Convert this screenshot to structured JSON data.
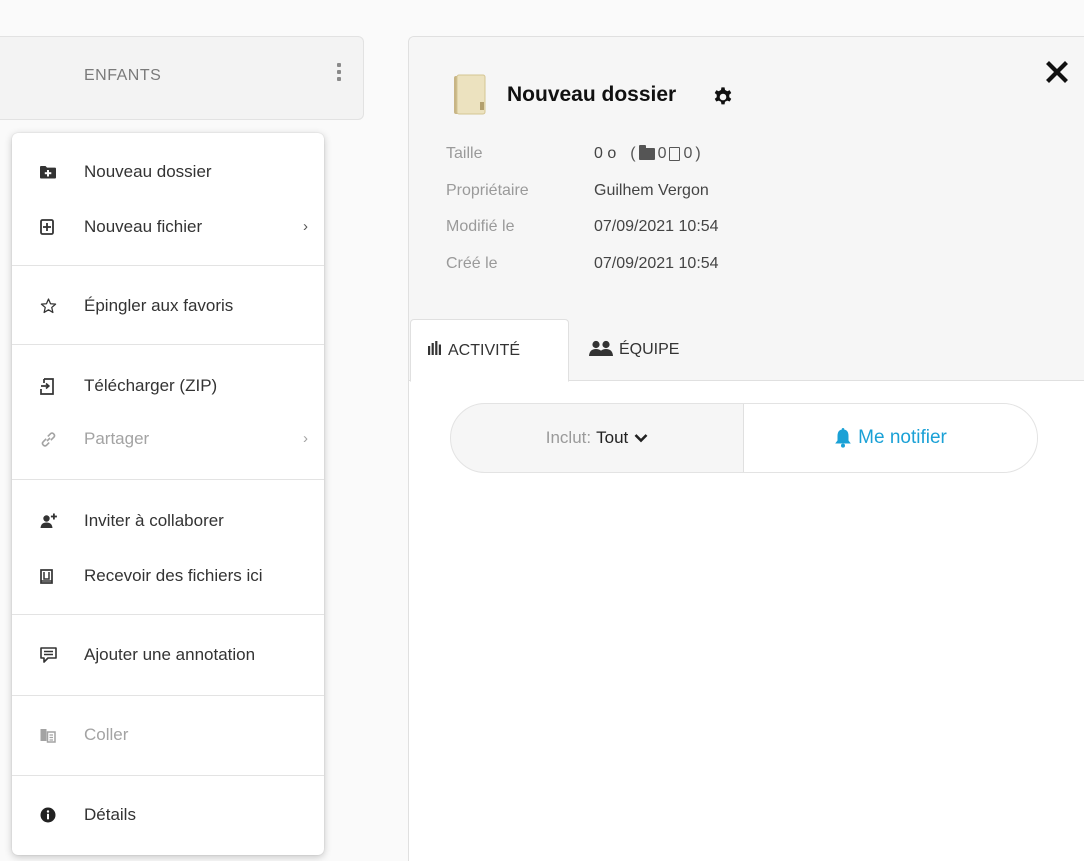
{
  "left_panel": {
    "title": "ENFANTS",
    "more_icon": "vertical-ellipsis-icon"
  },
  "context_menu": {
    "items": [
      {
        "label": "Nouveau dossier",
        "icon": "folder-plus-icon",
        "disabled": false,
        "submenu": false
      },
      {
        "label": "Nouveau fichier",
        "icon": "file-plus-icon",
        "disabled": false,
        "submenu": true
      },
      {
        "label": "Épingler aux favoris",
        "icon": "star-outline-icon",
        "disabled": false,
        "submenu": false
      },
      {
        "label": "Télécharger (ZIP)",
        "icon": "download-icon",
        "disabled": false,
        "submenu": false
      },
      {
        "label": "Partager",
        "icon": "share-link-icon",
        "disabled": true,
        "submenu": true
      },
      {
        "label": "Inviter à collaborer",
        "icon": "user-plus-icon",
        "disabled": false,
        "submenu": false
      },
      {
        "label": "Recevoir des fichiers ici",
        "icon": "inbox-upload-icon",
        "disabled": false,
        "submenu": false
      },
      {
        "label": "Ajouter une annotation",
        "icon": "comment-icon",
        "disabled": false,
        "submenu": false
      },
      {
        "label": "Coller",
        "icon": "paste-icon",
        "disabled": true,
        "submenu": false
      },
      {
        "label": "Détails",
        "icon": "info-icon",
        "disabled": false,
        "submenu": false
      }
    ],
    "submenu_arrow": "›"
  },
  "details_panel": {
    "folder_name": "Nouveau dossier",
    "close_icon": "close-icon",
    "settings_icon": "gear-icon",
    "meta": {
      "size_label": "Taille",
      "size_value": "0 o",
      "size_open": "(",
      "folder_count": "0",
      "file_count": "0",
      "size_close": ")",
      "owner_label": "Propriétaire",
      "owner_value": "Guilhem Vergon",
      "modified_label": "Modifié le",
      "modified_value": "07/09/2021 10:54",
      "created_label": "Créé le",
      "created_value": "07/09/2021 10:54"
    },
    "tabs": [
      {
        "label": "ACTIVITÉ",
        "icon": "bar-chart-icon",
        "active": true
      },
      {
        "label": "ÉQUIPE",
        "icon": "users-icon",
        "active": false
      }
    ],
    "activity": {
      "filter_label": "Inclut:",
      "filter_value": "Tout",
      "notify_label": "Me notifier",
      "notify_color": "#1aa1d6"
    }
  }
}
